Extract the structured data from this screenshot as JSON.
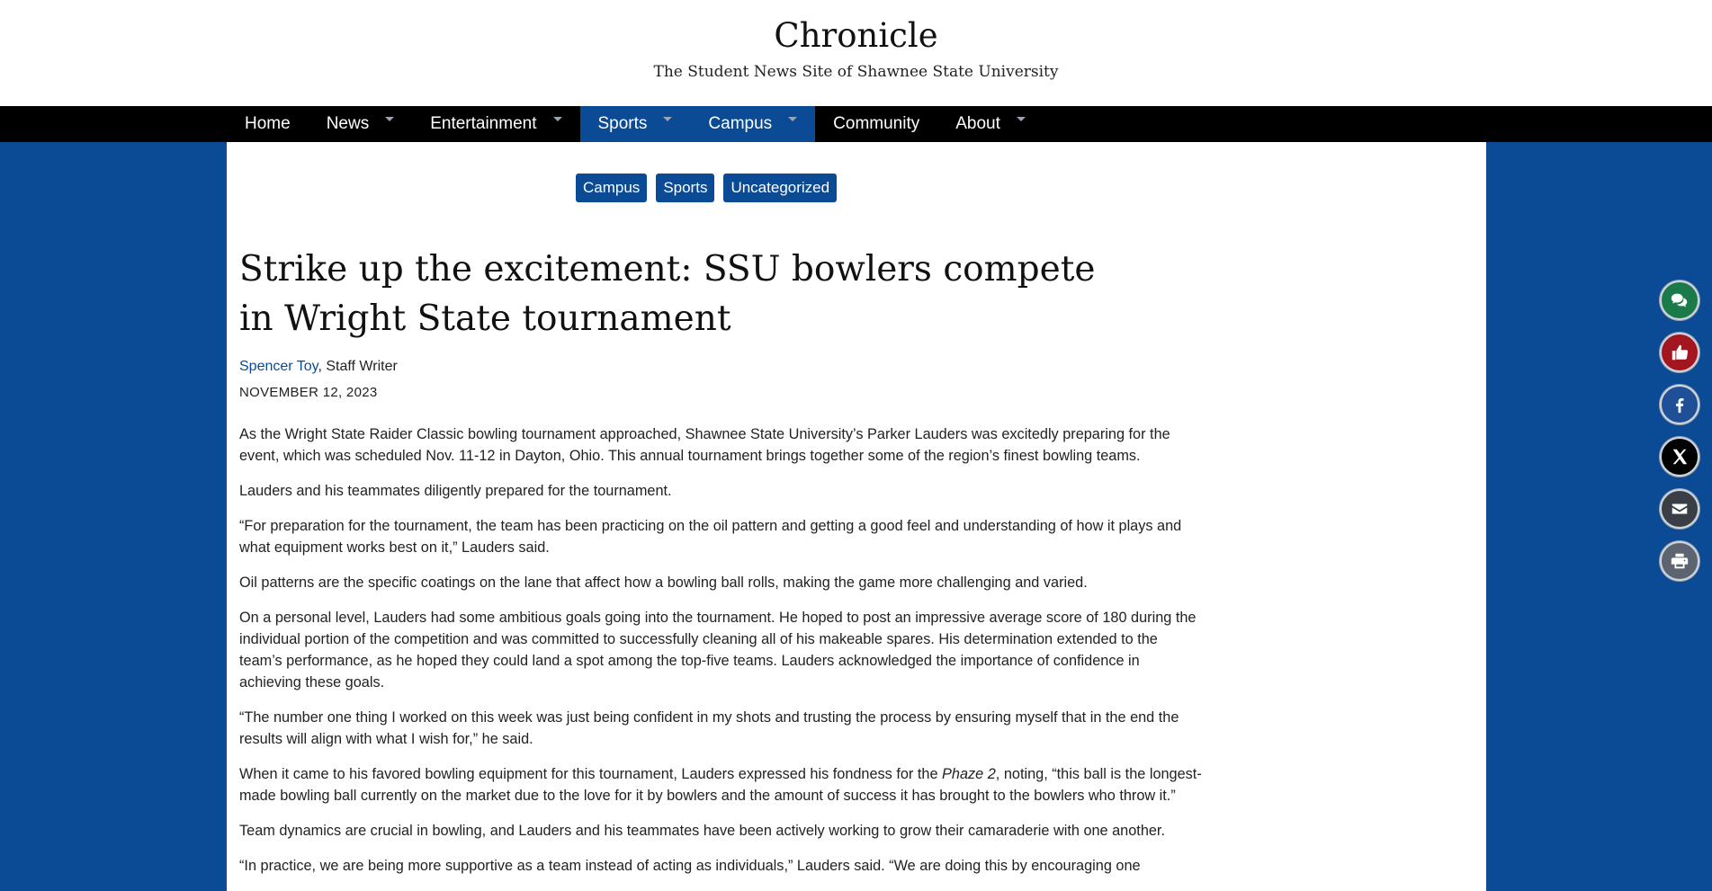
{
  "site": {
    "title": "Chronicle",
    "tagline": "The Student News Site of Shawnee State University"
  },
  "nav": {
    "items": [
      {
        "label": "Home",
        "has_dropdown": false,
        "active": false
      },
      {
        "label": "News",
        "has_dropdown": true,
        "active": false
      },
      {
        "label": "Entertainment",
        "has_dropdown": true,
        "active": false
      },
      {
        "label": "Sports",
        "has_dropdown": true,
        "active": true
      },
      {
        "label": "Campus",
        "has_dropdown": true,
        "active": true
      },
      {
        "label": "Community",
        "has_dropdown": false,
        "active": false
      },
      {
        "label": "About",
        "has_dropdown": true,
        "active": false
      }
    ]
  },
  "article": {
    "categories": [
      "Campus",
      "Sports",
      "Uncategorized"
    ],
    "headline": "Strike up the excitement: SSU bowlers compete in Wright State tournament",
    "author": "Spencer Toy",
    "author_role": ", Staff Writer",
    "date": "NOVEMBER 12, 2023",
    "paragraphs": [
      "As the Wright State Raider Classic bowling tournament approached, Shawnee State University’s Parker Lauders was excitedly preparing for the event, which was scheduled Nov. 11-12 in Dayton, Ohio. This annual tournament brings together some of the region’s finest bowling teams.",
      "Lauders and his teammates diligently prepared for the tournament.",
      "“For preparation for the tournament, the team has been practicing on the oil pattern and getting a good feel and understanding of how it plays and what equipment works best on it,” Lauders said.",
      "Oil patterns are the specific coatings on the lane that affect how a bowling ball rolls, making the game more challenging and varied.",
      "On a personal level, Lauders had some ambitious goals going into the tournament. He hoped to post an impressive average score of 180 during the individual portion of the competition and was committed to successfully cleaning all of his makeable spares. His determination extended to the team’s performance, as he hoped they could land a spot among the top-five teams. Lauders acknowledged the importance of confidence in achieving these goals.",
      "“The number one thing I worked on this week was just being confident in my shots and trusting the process by ensuring myself that in the end the results will align with what I wish for,” he said.",
      "When it came to his favored bowling equipment for this tournament, Lauders expressed his fondness for the ",
      "Team dynamics are crucial in bowling, and Lauders and his teammates have been actively working to grow their camaraderie with one another.",
      "“In practice, we are being more supportive as a team instead of acting as individuals,” Lauders said. “We are doing this by encouraging one"
    ],
    "p7_italic": "Phaze 2",
    "p7_rest": ", noting, “this ball is the longest-made bowling ball currently on the market due to the love for it by bowlers and the amount of success it has brought to the bowlers who throw it.”"
  },
  "share_buttons": [
    {
      "name": "comment-icon",
      "color": "#1b7a4a"
    },
    {
      "name": "like-icon",
      "color": "#a3161f"
    },
    {
      "name": "facebook-icon",
      "color": "#1f4f96"
    },
    {
      "name": "x-icon",
      "color": "#000000"
    },
    {
      "name": "email-icon",
      "color": "#3a3f47"
    },
    {
      "name": "print-icon",
      "color": "#5b6470"
    }
  ],
  "colors": {
    "brand_blue": "#0b4a94",
    "nav_bg": "#000000"
  }
}
